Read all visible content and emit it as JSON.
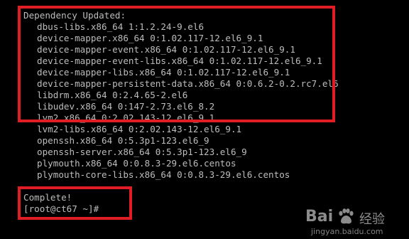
{
  "terminal": {
    "colors": {
      "background": "#000000",
      "text": "#bdbdbd",
      "highlight_box": "#e01c24"
    },
    "header": "Dependency Updated:",
    "packages": [
      "dbus-libs.x86_64 1:1.2.24-9.el6",
      "device-mapper.x86_64 0:1.02.117-12.el6_9.1",
      "device-mapper-event.x86_64 0:1.02.117-12.el6_9.1",
      "device-mapper-event-libs.x86_64 0:1.02.117-12.el6_9.1",
      "device-mapper-libs.x86_64 0:1.02.117-12.el6_9.1",
      "device-mapper-persistent-data.x86_64 0:0.6.2-0.2.rc7.el6",
      "libdrm.x86_64 0:2.4.65-2.el6",
      "libudev.x86_64 0:147-2.73.el6_8.2",
      "lvm2.x86_64 0:2.02.143-12.el6_9.1",
      "lvm2-libs.x86_64 0:2.02.143-12.el6_9.1",
      "openssh.x86_64 0:5.3p1-123.el6_9",
      "openssh-server.x86_64 0:5.3p1-123.el6_9",
      "plymouth.x86_64 0:0.8.3-29.el6.centos",
      "plymouth-core-libs.x86_64 0:0.8.3-29.el6.centos"
    ],
    "complete": "Complete!",
    "prompt": "[root@ct67 ~]#"
  },
  "watermark": {
    "logo_text": "Bai",
    "logo_cn": "经验",
    "url": "jingyan.baidu.com"
  }
}
